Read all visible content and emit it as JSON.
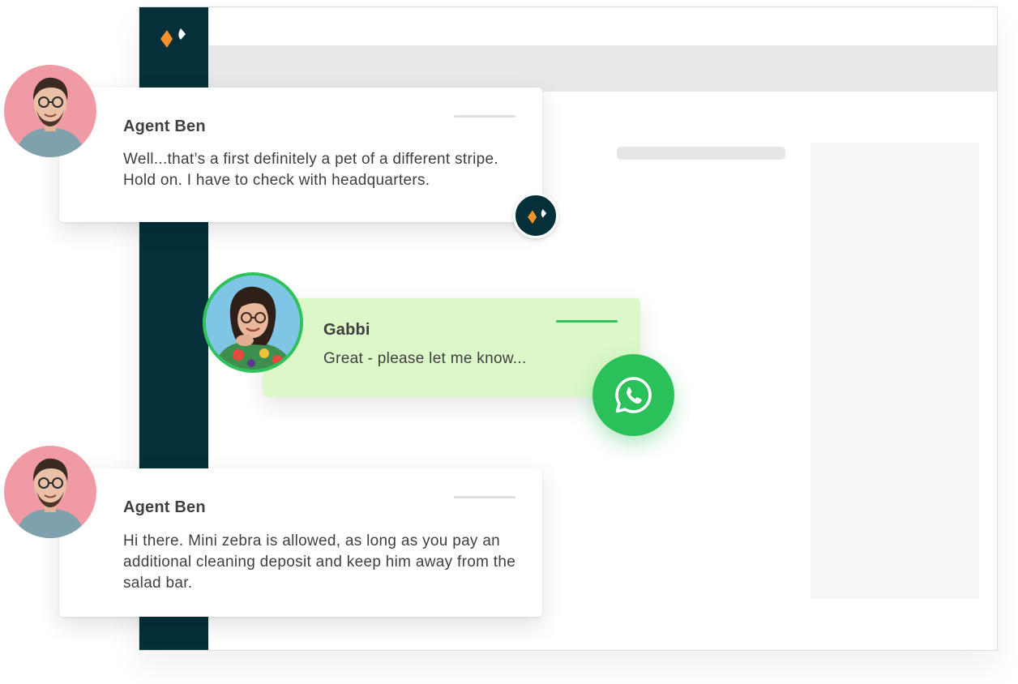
{
  "brand": {
    "sidebar_color": "#04303a",
    "accent_orange": "#f5922b",
    "whatsapp_green": "#2bc15a",
    "logo_icon": "brand-logo-icon"
  },
  "messages": [
    {
      "sender": "Agent Ben",
      "text": "Well...that’s a first definitely a pet of a different stripe. Hold on. I have to check with headquarters.",
      "channel_icon": "brand-logo-icon"
    },
    {
      "sender": "Gabbi",
      "text": "Great - please let me know...",
      "channel_icon": "whatsapp-icon"
    },
    {
      "sender": "Agent Ben",
      "text": "Hi there. Mini zebra is allowed, as long as you pay an additional cleaning deposit and keep him away from the salad bar."
    }
  ]
}
